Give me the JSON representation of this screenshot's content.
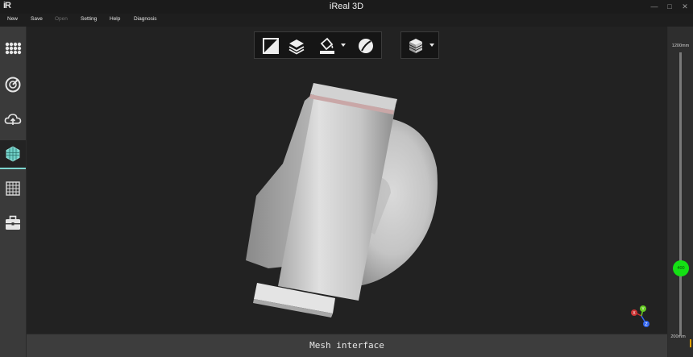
{
  "app": {
    "logo_text": "iR",
    "title": "iReal 3D",
    "window_controls": {
      "minimize": "—",
      "maximize": "□",
      "close": "✕"
    }
  },
  "menu": {
    "items": [
      {
        "label": "New",
        "enabled": true
      },
      {
        "label": "Save",
        "enabled": true
      },
      {
        "label": "Open",
        "enabled": false
      },
      {
        "label": "Setting",
        "enabled": true
      },
      {
        "label": "Help",
        "enabled": true
      },
      {
        "label": "Diagnosis",
        "enabled": true
      }
    ]
  },
  "sidebar": {
    "items": [
      {
        "icon": "dots-grid-icon",
        "active": false
      },
      {
        "icon": "scan-target-icon",
        "active": false
      },
      {
        "icon": "cloud-upload-icon",
        "active": false
      },
      {
        "icon": "mesh-icon",
        "active": true
      },
      {
        "icon": "grid-icon",
        "active": false
      },
      {
        "icon": "toolbox-icon",
        "active": false
      }
    ]
  },
  "toolbar": {
    "group1": [
      "crop-icon",
      "layers-icon",
      "fill-icon",
      "texture-icon"
    ],
    "group2": [
      "cube-layers-icon"
    ]
  },
  "status": {
    "text": "Mesh interface"
  },
  "distance": {
    "max_label": "1200mm",
    "min_label": "200mm",
    "value_label": "400",
    "max": 1200,
    "min": 200,
    "value": 400,
    "knob_color": "#14e014"
  },
  "axes": {
    "x": "X",
    "y": "Y",
    "z": "Z"
  },
  "colors": {
    "accent": "#7fd7d0",
    "background": "#222222"
  }
}
